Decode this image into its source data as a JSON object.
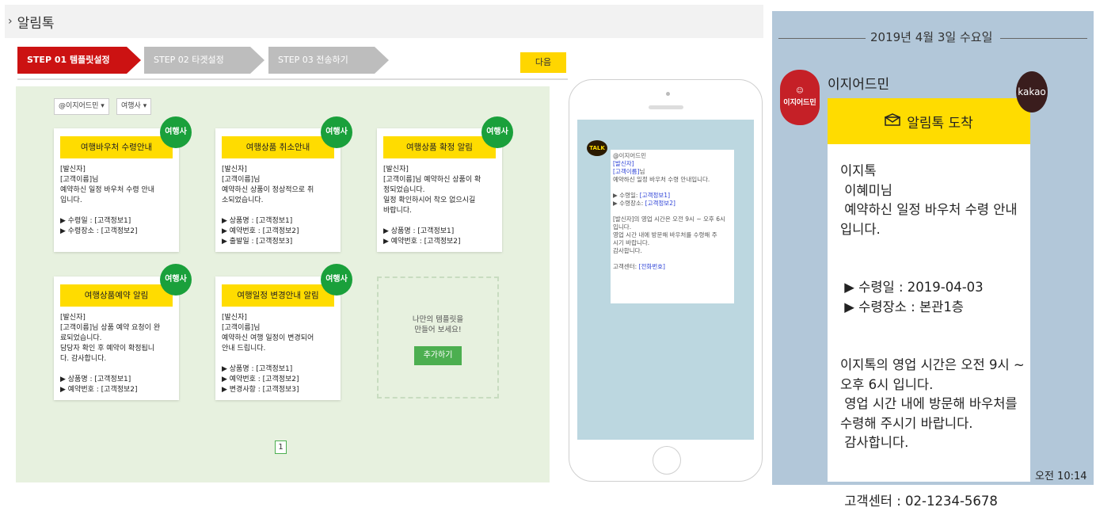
{
  "header": {
    "title": "알림톡"
  },
  "steps": [
    {
      "label": "STEP 01 템플릿설정"
    },
    {
      "label": "STEP 02 타겟설정"
    },
    {
      "label": "STEP 03 전송하기"
    }
  ],
  "next_label": "다음",
  "filters": [
    "@이지어드민 ▾",
    "여행사 ▾"
  ],
  "cards": [
    {
      "title": "여행바우처 수령안내",
      "badge": "여행사",
      "body": "[발신자]\n[고객이름]님\n예약하신 일정 바우처 수령 안내\n입니다.\n\n▶ 수령일 : [고객정보1]\n▶ 수령장소 : [고객정보2]"
    },
    {
      "title": "여행상품 취소안내",
      "badge": "여행사",
      "body": "[발신자]\n[고객이름]님\n예약하신 상품이 정상적으로 취\n소되었습니다.\n\n▶ 상품명 : [고객정보1]\n▶ 예약번호 : [고객정보2]\n▶ 출발일 : [고객정보3]"
    },
    {
      "title": "여행상품 확정 알림",
      "badge": "여행사",
      "body": "[발신자]\n[고객이름]님 예약하신 상품이 확\n정되었습니다.\n일정 확인하시어 착오 없으시길\n바랍니다.\n\n▶ 상품명 : [고객정보1]\n▶ 예약번호 : [고객정보2]"
    },
    {
      "title": "여행상품예약 알림",
      "badge": "여행사",
      "body": "[발신자]\n[고객이름]님 상품 예약 요청이 완\n료되었습니다.\n담당자 확인 후 예약이 확정됩니\n다. 감사합니다.\n\n▶ 상품명 : [고객정보1]\n▶ 예약번호 : [고객정보2]"
    },
    {
      "title": "여행일정 변경안내 알림",
      "badge": "여행사",
      "body": "[발신자]\n[고객이름]님\n예약하신 여행 일정이 변경되어\n안내 드립니다.\n\n▶ 상품명 : [고객정보1]\n▶ 예약번호 : [고객정보2]\n▶ 변경사항 : [고객정보3]"
    }
  ],
  "add_card": {
    "text": "나만의 템플릿을\n만들어 보세요!",
    "button": "추가하기"
  },
  "pagination": {
    "current": "1"
  },
  "phone_preview": {
    "talk": "TALK",
    "sender": "@이지어드민",
    "lines": [
      {
        "text": "[발신자]",
        "blue": true
      },
      {
        "text": "[고객이름]",
        "blue": true,
        "suffix": "님"
      },
      {
        "text": "예약하신 일정 바우처 수령 안내입니다.",
        "blue": false
      },
      {
        "text": "",
        "blue": false
      },
      {
        "text": "▶ 수령일: ",
        "blue": false,
        "suffix_blue": "[고객정보1]"
      },
      {
        "text": "▶ 수령장소: ",
        "blue": false,
        "suffix_blue": "[고객정보2]"
      },
      {
        "text": "",
        "blue": false
      },
      {
        "text": "[발신자]의 영업 시간은 오전 9시 ~ 오후 6시",
        "blue": false
      },
      {
        "text": "입니다.",
        "blue": false
      },
      {
        "text": "영업 시간 내에 방문해 바우처를 수령해 주",
        "blue": false
      },
      {
        "text": "시기 바랍니다.",
        "blue": false
      },
      {
        "text": "감사합니다.",
        "blue": false
      },
      {
        "text": "",
        "blue": false
      },
      {
        "text": "고객센터: ",
        "blue": false,
        "suffix_blue": "[전화번호]"
      }
    ]
  },
  "chat": {
    "date": "2019년 4월 3일 수요일",
    "sender_name": "이지어드민",
    "avatar_text": "이지어드민",
    "kakao_badge": "kakao",
    "header": "알림톡 도착",
    "lines": [
      "이지톡",
      " 이혜미님",
      " 예약하신 일정 바우처 수령 안내",
      "입니다.",
      "",
      "",
      " ▶ 수령일 : 2019-04-03",
      " ▶ 수령장소 : 본관1층",
      "",
      "",
      "이지톡의 영업 시간은 오전 9시 ~",
      "오후 6시 입니다.",
      " 영업 시간 내에 방문해 바우처를",
      "수령해 주시기 바랍니다.",
      " 감사합니다.",
      "",
      "",
      " 고객센터 : 02-1234-5678"
    ],
    "time": "오전 10:14"
  }
}
